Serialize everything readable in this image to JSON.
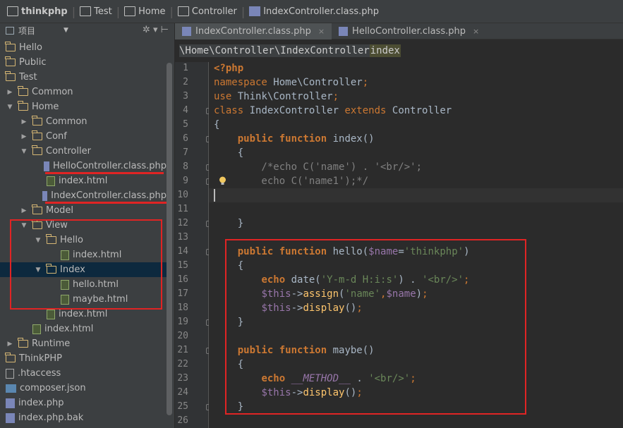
{
  "breadcrumb": [
    {
      "label": "thinkphp",
      "icon": "project-folder-icon"
    },
    {
      "label": "Test",
      "icon": "folder-icon"
    },
    {
      "label": "Home",
      "icon": "folder-icon"
    },
    {
      "label": "Controller",
      "icon": "folder-icon"
    },
    {
      "label": "IndexController.class.php",
      "icon": "php-file-icon"
    }
  ],
  "project_panel": {
    "title": "项目",
    "tree": [
      {
        "label": "Hello",
        "type": "folder",
        "depth": 0,
        "arrow": ""
      },
      {
        "label": "Public",
        "type": "folder",
        "depth": 0,
        "arrow": ""
      },
      {
        "label": "Test",
        "type": "folder",
        "depth": 0,
        "arrow": ""
      },
      {
        "label": "Common",
        "type": "folder",
        "depth": 0,
        "arrow": "collapsed"
      },
      {
        "label": "Home",
        "type": "folder",
        "depth": 0,
        "arrow": "expanded"
      },
      {
        "label": "Common",
        "type": "folder",
        "depth": 1,
        "arrow": "collapsed"
      },
      {
        "label": "Conf",
        "type": "folder",
        "depth": 1,
        "arrow": "collapsed"
      },
      {
        "label": "Controller",
        "type": "folder",
        "depth": 1,
        "arrow": "expanded"
      },
      {
        "label": "HelloController.class.php",
        "type": "php",
        "depth": 2,
        "arrow": ""
      },
      {
        "label": "index.html",
        "type": "html",
        "depth": 2,
        "arrow": ""
      },
      {
        "label": "IndexController.class.php",
        "type": "php",
        "depth": 2,
        "arrow": ""
      },
      {
        "label": "Model",
        "type": "folder",
        "depth": 1,
        "arrow": "collapsed"
      },
      {
        "label": "View",
        "type": "folder",
        "depth": 1,
        "arrow": "expanded"
      },
      {
        "label": "Hello",
        "type": "folder",
        "depth": 2,
        "arrow": "expanded"
      },
      {
        "label": "index.html",
        "type": "html",
        "depth": 3,
        "arrow": ""
      },
      {
        "label": "Index",
        "type": "folder",
        "depth": 2,
        "arrow": "expanded",
        "selected": true
      },
      {
        "label": "hello.html",
        "type": "html",
        "depth": 3,
        "arrow": ""
      },
      {
        "label": "maybe.html",
        "type": "html",
        "depth": 3,
        "arrow": ""
      },
      {
        "label": "index.html",
        "type": "html",
        "depth": 2,
        "arrow": ""
      },
      {
        "label": "index.html",
        "type": "html",
        "depth": 1,
        "arrow": ""
      },
      {
        "label": "Runtime",
        "type": "folder",
        "depth": 0,
        "arrow": "collapsed"
      },
      {
        "label": "ThinkPHP",
        "type": "folder",
        "depth": 0,
        "arrow": ""
      },
      {
        "label": ".htaccess",
        "type": "generic",
        "depth": 0,
        "arrow": ""
      },
      {
        "label": "composer.json",
        "type": "json",
        "depth": 0,
        "arrow": ""
      },
      {
        "label": "index.php",
        "type": "php",
        "depth": 0,
        "arrow": ""
      },
      {
        "label": "index.php.bak",
        "type": "php",
        "depth": 0,
        "arrow": ""
      }
    ]
  },
  "tabs": [
    {
      "label": "IndexController.class.php",
      "active": true
    },
    {
      "label": "HelloController.class.php",
      "active": false
    }
  ],
  "namespace_path": "\\Home\\Controller\\IndexController",
  "namespace_method": "index",
  "line_numbers": [
    "1",
    "2",
    "3",
    "4",
    "5",
    "6",
    "7",
    "8",
    "9",
    "10",
    "11",
    "12",
    "13",
    "14",
    "15",
    "16",
    "17",
    "18",
    "19",
    "20",
    "21",
    "22",
    "23",
    "24",
    "25",
    "26"
  ],
  "code_lines": [
    [
      [
        "php",
        "<?php"
      ]
    ],
    [
      [
        "kwn",
        "namespace"
      ],
      [
        "cls",
        " Home\\Controller"
      ],
      [
        "kwn",
        ";"
      ]
    ],
    [
      [
        "kwn",
        "use"
      ],
      [
        "cls",
        " Think\\Controller"
      ],
      [
        "kwn",
        ";"
      ]
    ],
    [
      [
        "kwn",
        "class"
      ],
      [
        "cls",
        " IndexController "
      ],
      [
        "kwn",
        "extends"
      ],
      [
        "cls",
        " Controller"
      ]
    ],
    [
      [
        "cls",
        "{"
      ]
    ],
    [
      [
        "cls",
        "    "
      ],
      [
        "kw",
        "public function"
      ],
      [
        "cls",
        " index()"
      ]
    ],
    [
      [
        "cls",
        "    {"
      ]
    ],
    [
      [
        "cmt",
        "        /*echo C('name') . '<br/>';"
      ]
    ],
    [
      [
        "cmt",
        "        echo C('name1');*/"
      ]
    ],
    [
      [
        "cls",
        ""
      ]
    ],
    [
      [
        "cls",
        ""
      ]
    ],
    [
      [
        "cls",
        "    }"
      ]
    ],
    [
      [
        "cls",
        ""
      ]
    ],
    [
      [
        "cls",
        "    "
      ],
      [
        "kw",
        "public function"
      ],
      [
        "cls",
        " hello("
      ],
      [
        "var",
        "$name"
      ],
      [
        "cls",
        "="
      ],
      [
        "str",
        "'thinkphp'"
      ],
      [
        "cls",
        ")"
      ]
    ],
    [
      [
        "cls",
        "    {"
      ]
    ],
    [
      [
        "cls",
        "        "
      ],
      [
        "kw",
        "echo"
      ],
      [
        "cls",
        " date("
      ],
      [
        "str",
        "'Y-m-d H:i:s'"
      ],
      [
        "cls",
        ") . "
      ],
      [
        "str",
        "'<br/>'"
      ],
      [
        "kwn",
        ";"
      ]
    ],
    [
      [
        "cls",
        "        "
      ],
      [
        "var",
        "$this"
      ],
      [
        "cls",
        "->"
      ],
      [
        "fn",
        "assign"
      ],
      [
        "cls",
        "("
      ],
      [
        "str",
        "'name'"
      ],
      [
        "kwn",
        ","
      ],
      [
        "var",
        "$name"
      ],
      [
        "cls",
        ")"
      ],
      [
        "kwn",
        ";"
      ]
    ],
    [
      [
        "cls",
        "        "
      ],
      [
        "var",
        "$this"
      ],
      [
        "cls",
        "->"
      ],
      [
        "fn",
        "display"
      ],
      [
        "cls",
        "()"
      ],
      [
        "kwn",
        ";"
      ]
    ],
    [
      [
        "cls",
        "    }"
      ]
    ],
    [
      [
        "cls",
        ""
      ]
    ],
    [
      [
        "cls",
        "    "
      ],
      [
        "kw",
        "public function"
      ],
      [
        "cls",
        " maybe()"
      ]
    ],
    [
      [
        "cls",
        "    {"
      ]
    ],
    [
      [
        "cls",
        "        "
      ],
      [
        "kw",
        "echo"
      ],
      [
        "cls",
        " "
      ],
      [
        "mc",
        "__METHOD__"
      ],
      [
        "cls",
        " . "
      ],
      [
        "str",
        "'<br/>'"
      ],
      [
        "kwn",
        ";"
      ]
    ],
    [
      [
        "cls",
        "        "
      ],
      [
        "var",
        "$this"
      ],
      [
        "cls",
        "->"
      ],
      [
        "fn",
        "display"
      ],
      [
        "cls",
        "()"
      ],
      [
        "kwn",
        ";"
      ]
    ],
    [
      [
        "cls",
        "    }"
      ]
    ],
    [
      [
        "cls",
        ""
      ]
    ]
  ],
  "colors": {
    "annotation": "#e02424",
    "keyword": "#cc7832",
    "string": "#6a8759",
    "variable": "#9876aa"
  }
}
